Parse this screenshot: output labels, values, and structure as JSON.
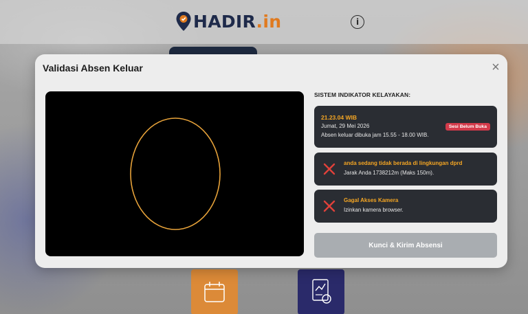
{
  "app": {
    "logo_main": "HADIR",
    "logo_suffix": ".in",
    "info_icon": "info-icon",
    "colors": {
      "brand_navy": "#1e2a4a",
      "brand_orange": "#e07a1f"
    }
  },
  "modal": {
    "title": "Validasi Absen Keluar",
    "close_label": "×",
    "camera": {
      "face_guide": "oval",
      "guide_color": "#e8a33a"
    },
    "indicator_heading": "SISTEM INDIKATOR KELAYAKAN:",
    "session": {
      "time": "21.23.04 WIB",
      "date": "Jumat, 29 Mei 2026",
      "note": "Absen keluar dibuka jam 15.55 - 18.00 WIB.",
      "badge": "Sesi Belum Buka",
      "badge_color": "#d33a4a"
    },
    "checks": [
      {
        "icon": "x-icon",
        "title": "anda sedang tidak berada di lingkungan dprd",
        "detail": "Jarak Anda 1738212m (Maks 150m)."
      },
      {
        "icon": "x-icon",
        "title": "Gagal Akses Kamera",
        "detail": "Izinkan kamera browser."
      }
    ],
    "submit_label": "Kunci & Kirim Absensi"
  }
}
